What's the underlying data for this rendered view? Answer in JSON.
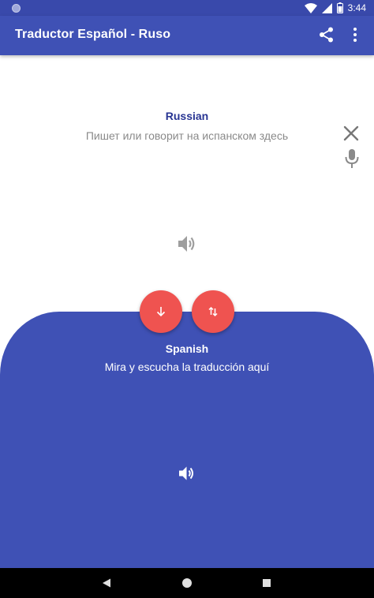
{
  "status_bar": {
    "time": "3:44"
  },
  "app_bar": {
    "title": "Traductor Español - Ruso"
  },
  "source": {
    "language": "Russian",
    "placeholder": "Пишет или говорит на испанском здесь"
  },
  "target": {
    "language": "Spanish",
    "text": "Mira y escucha la traducción aquí"
  },
  "colors": {
    "primary": "#3f51b5",
    "primary_dark": "#3949ab",
    "accent": "#ef5350",
    "source_label": "#283593"
  },
  "icons": {
    "status_left": "notification-dot-icon",
    "wifi": "wifi-icon",
    "signal": "signal-icon",
    "battery": "battery-icon",
    "share": "share-icon",
    "more": "more-vert-icon",
    "clear": "close-icon",
    "mic": "mic-icon",
    "speaker": "volume-up-icon",
    "translate": "arrow-down-icon",
    "swap": "swap-vert-icon",
    "nav_back": "back-icon",
    "nav_home": "home-icon",
    "nav_recent": "recent-apps-icon"
  }
}
